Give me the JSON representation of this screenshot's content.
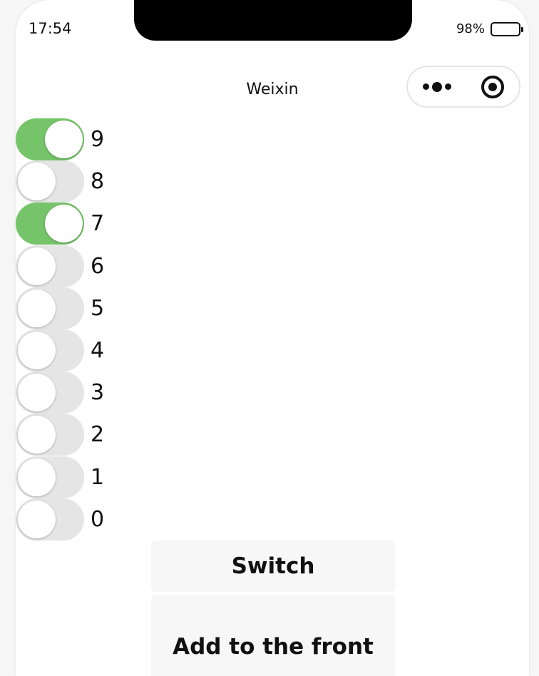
{
  "status_bar": {
    "time": "17:54",
    "battery": "98%"
  },
  "nav": {
    "title": "Weixin"
  },
  "switches": [
    {
      "label": "9",
      "on": true
    },
    {
      "label": "8",
      "on": false
    },
    {
      "label": "7",
      "on": true
    },
    {
      "label": "6",
      "on": false
    },
    {
      "label": "5",
      "on": false
    },
    {
      "label": "4",
      "on": false
    },
    {
      "label": "3",
      "on": false
    },
    {
      "label": "2",
      "on": false
    },
    {
      "label": "1",
      "on": false
    },
    {
      "label": "0",
      "on": false
    }
  ],
  "buttons": {
    "switch_label": "Switch",
    "add_front_label": "Add to the front"
  },
  "colors": {
    "switch_on": "#76c46a",
    "switch_off": "#e5e5e5"
  }
}
